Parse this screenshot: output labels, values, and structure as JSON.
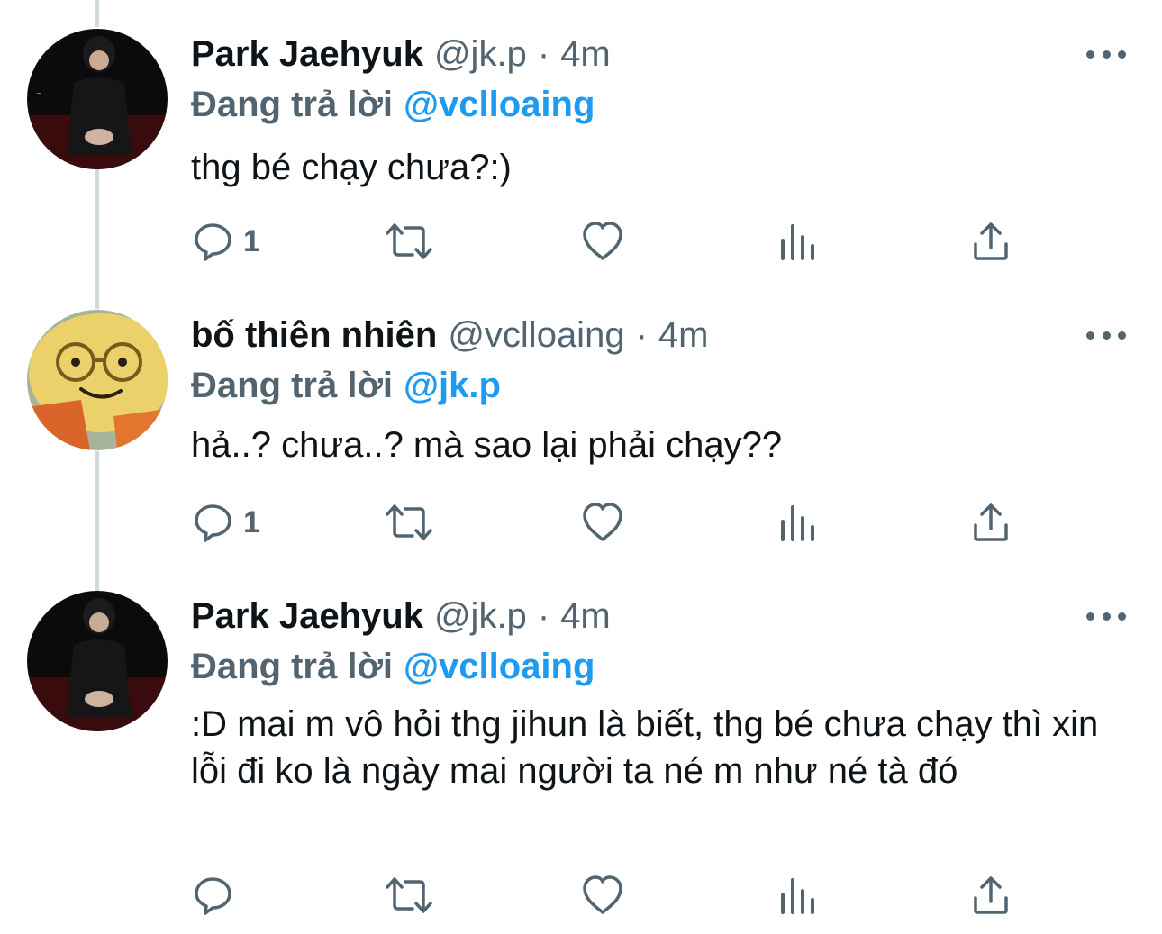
{
  "tweets": [
    {
      "name": "Park Jaehyuk",
      "handle": "@jk.p",
      "separator": "·",
      "time": "4m",
      "reply_prefix": "Đang trả lời",
      "reply_handle": "@vclloaing",
      "text": "thg bé chạy chưa?:)",
      "reply_count": "1",
      "avatar": "dark-photo-avatar"
    },
    {
      "name": "bố thiên nhiên",
      "handle": "@vclloaing",
      "separator": "·",
      "time": "4m",
      "reply_prefix": "Đang trả lời",
      "reply_handle": "@jk.p",
      "text": "hả..? chưa..? mà sao lại phải chạy??",
      "reply_count": "1",
      "avatar": "yellow-plush-avatar"
    },
    {
      "name": "Park Jaehyuk",
      "handle": "@jk.p",
      "separator": "·",
      "time": "4m",
      "reply_prefix": "Đang trả lời",
      "reply_handle": "@vclloaing",
      "text": ":D mai m vô hỏi thg jihun là biết, thg bé chưa chạy thì xin lỗi đi ko là ngày mai người ta né m như né tà đó",
      "reply_count": "",
      "avatar": "dark-photo-avatar"
    }
  ],
  "icons": {
    "reply": "comment-icon",
    "retweet": "retweet-icon",
    "like": "heart-icon",
    "views": "analytics-icon",
    "share": "share-icon",
    "more": "more-icon"
  },
  "colors": {
    "text": "#0f1419",
    "secondary": "#536471",
    "accent": "#1d9bf0",
    "thread_line": "#cfd9de"
  }
}
